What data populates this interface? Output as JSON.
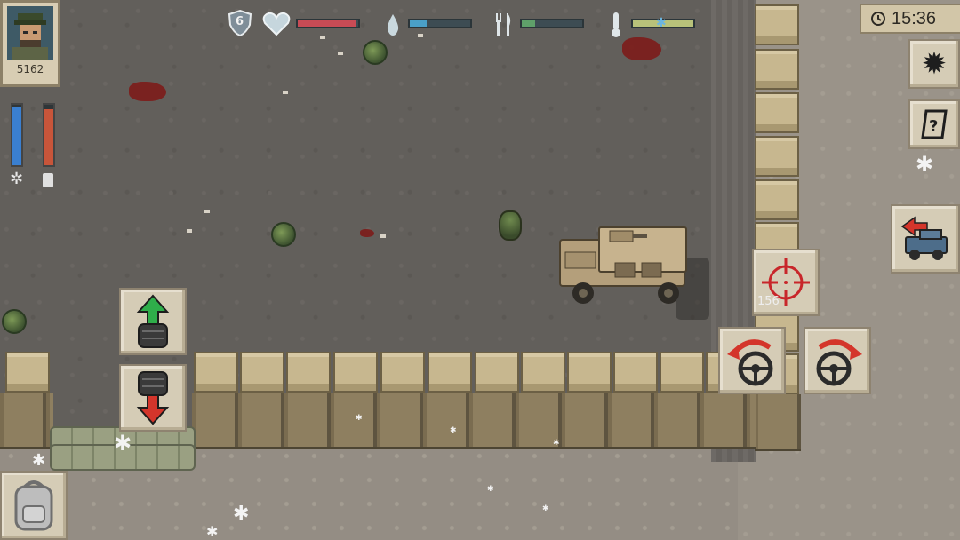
{
  "hud": {
    "player_score": "5162",
    "clock_time": "15:36",
    "armor_level": "6",
    "stats": [
      {
        "name": "health",
        "icon": "heart-icon",
        "fill": 0.95,
        "color": "#c84b55"
      },
      {
        "name": "thirst",
        "icon": "water-drop-icon",
        "fill": 0.28,
        "color": "#4aa0c8"
      },
      {
        "name": "hunger",
        "icon": "fork-knife-icon",
        "fill": 0.22,
        "color": "#5fa06a"
      },
      {
        "name": "temperature",
        "icon": "thermometer-icon",
        "fill": 1.0,
        "color": "#b8c27a"
      }
    ],
    "side_bars": [
      {
        "name": "stamina",
        "icon": "gear-icon",
        "fill": 0.95,
        "color": "#3a7fd0"
      },
      {
        "name": "fuel",
        "icon": "battery-icon",
        "fill": 0.92,
        "color": "#c8553a"
      }
    ],
    "ammo_count": "156"
  },
  "controls": {
    "gear_up_icon": "gear-shift-up-icon",
    "gear_down_icon": "gear-shift-down-icon",
    "steer_left_icon": "steer-left-icon",
    "steer_right_icon": "steer-right-icon",
    "aim_icon": "crosshair-icon",
    "exit_vehicle_icon": "exit-vehicle-icon",
    "settings_icon": "settings-gear-icon",
    "quests_icon": "quest-notepad-icon",
    "backpack_icon": "backpack-icon"
  },
  "colors": {
    "accent_red": "#d4352b",
    "accent_green": "#2fae4a",
    "panel": "#d5ccb6"
  }
}
